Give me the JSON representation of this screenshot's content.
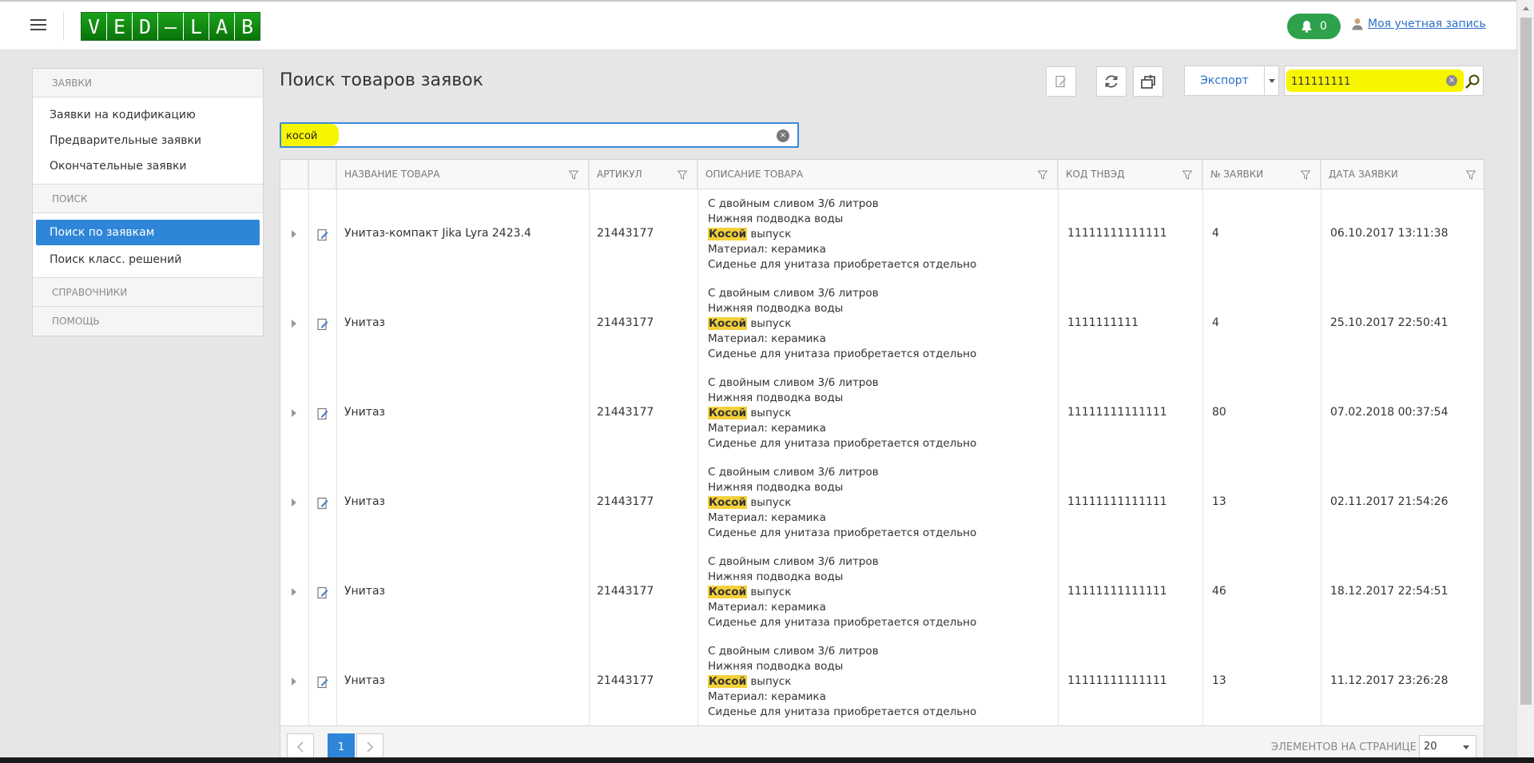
{
  "header": {
    "logo_letters": [
      "V",
      "E",
      "D",
      "–",
      "L",
      "A",
      "B"
    ],
    "notification_count": "0",
    "account_label": "Моя учетная запись"
  },
  "sidebar": {
    "sections": [
      {
        "label": "ЗАЯВКИ",
        "items": [
          "Заявки на кодификацию",
          "Предварительные заявки",
          "Окончательные заявки"
        ]
      },
      {
        "label": "ПОИСК",
        "items": [
          "Поиск по заявкам",
          "Поиск класс. решений"
        ]
      },
      {
        "label": "СПРАВОЧНИКИ",
        "items": []
      },
      {
        "label": "ПОМОЩЬ",
        "items": []
      }
    ],
    "active_item": "Поиск по заявкам"
  },
  "page": {
    "title": "Поиск товаров заявок",
    "export_label": "Экспорт",
    "top_search_value": "111111111",
    "filter_value": "косой"
  },
  "grid": {
    "columns": [
      "НАЗВАНИЕ ТОВАРА",
      "АРТИКУЛ",
      "ОПИСАНИЕ ТОВАРА",
      "КОД ТНВЭД",
      "№ ЗАЯВКИ",
      "ДАТА ЗАЯВКИ"
    ],
    "description": {
      "line1": "С двойным сливом 3/6 литров",
      "line2": "Нижняя подводка воды",
      "highlight": "Косой",
      "line3_rest": " выпуск",
      "line4": "Материал: керамика",
      "line5": "Сиденье для унитаза приобретается отдельно"
    },
    "rows": [
      {
        "name": "Унитаз-компакт Jika Lyra 2423.4",
        "article": "21443177",
        "code": "11111111111111",
        "order": "4",
        "date": "06.10.2017 13:11:38"
      },
      {
        "name": "Унитаз",
        "article": "21443177",
        "code": "1111111111",
        "order": "4",
        "date": "25.10.2017 22:50:41"
      },
      {
        "name": "Унитаз",
        "article": "21443177",
        "code": "11111111111111",
        "order": "80",
        "date": "07.02.2018 00:37:54"
      },
      {
        "name": "Унитаз",
        "article": "21443177",
        "code": "11111111111111",
        "order": "13",
        "date": "02.11.2017 21:54:26"
      },
      {
        "name": "Унитаз",
        "article": "21443177",
        "code": "11111111111111",
        "order": "46",
        "date": "18.12.2017 22:54:51"
      },
      {
        "name": "Унитаз",
        "article": "21443177",
        "code": "11111111111111",
        "order": "13",
        "date": "11.12.2017 23:26:28"
      }
    ]
  },
  "pager": {
    "current_page": "1",
    "per_page_label": "ЭЛЕМЕНТОВ НА СТРАНИЦЕ",
    "per_page_value": "20"
  },
  "colors": {
    "accent": "#2f86d8",
    "logo_green": "#1aa21a",
    "notif_green": "#2ea14c",
    "highlight_yellow": "#f7f500",
    "match_mark": "#f4d13a"
  }
}
